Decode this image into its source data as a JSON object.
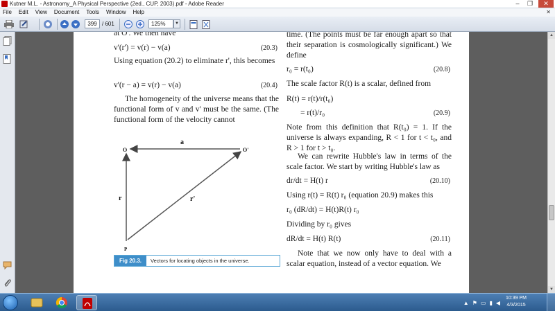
{
  "window": {
    "title": "Kutner M.L. - Astronomy_A Physical Perspective (2ed., CUP, 2003).pdf - Adobe Reader",
    "controls": [
      "–",
      "❐",
      "✕"
    ]
  },
  "menu": {
    "items": [
      "File",
      "Edit",
      "View",
      "Document",
      "Tools",
      "Window",
      "Help"
    ],
    "close": "✕"
  },
  "toolbar": {
    "page_current": "399",
    "page_total": "/ 601",
    "zoom": "125%"
  },
  "doc": {
    "left": {
      "t1": "at O'. We then have",
      "eq1": {
        "expr": "v'(r') = v(r) − v(a)",
        "num": "(20.3)"
      },
      "t2": "Using equation (20.2) to eliminate r', this becomes",
      "eq2": {
        "expr": "v'(r − a) = v(r) − v(a)",
        "num": "(20.4)"
      },
      "t3": "The homogeneity of the universe means that the functional form of v and v' must be the same. (The functional form of the velocity cannot"
    },
    "figure": {
      "labels": {
        "O": "O",
        "Op": "O'",
        "a": "a",
        "r": "r",
        "rp": "r'",
        "P": "P"
      },
      "caption_tag": "Fig 20.3.",
      "caption_text": "Vectors for locating objects in the universe."
    },
    "right": {
      "t1": "time. (The points must be far enough apart so that their separation is cosmologically significant.) We define",
      "eq1": {
        "expr": "r₀ = r(t₀)",
        "num": "(20.8)"
      },
      "t2": "The scale factor R(t) is a scalar, defined from",
      "eq2a": {
        "expr": "R(t) = r(t)/r(t₀)",
        "num": ""
      },
      "eq2b": {
        "expr": "= r(t)/r₀",
        "num": "(20.9)"
      },
      "t3": "Note from this definition that R(t₀) = 1. If the universe is always expanding, R < 1 for t < t₀, and R > 1 for t > t₀.",
      "t4": "We can rewrite Hubble's law in terms of the scale factor. We start by writing Hubble's law as",
      "eq3": {
        "expr": "dr/dt = H(t) r",
        "num": "(20.10)"
      },
      "t5": "Using r(t) = R(t) r₀ (equation 20.9) makes this",
      "eq4": {
        "expr": "r₀ (dR/dt) = H(t)R(t) r₀",
        "num": ""
      },
      "t6": "Dividing by r₀ gives",
      "eq5": {
        "expr": "dR/dt = H(t) R(t)",
        "num": "(20.11)"
      },
      "t7": "Note that we now only have to deal with a scalar equation, instead of a vector equation. We"
    }
  },
  "taskbar": {
    "time": "10:39 PM",
    "date": "4/3/2015"
  },
  "colors": {
    "caption_tag": "#3e8ec9",
    "taskbar": "#2c5b8e",
    "app_icon": "#c00000"
  }
}
